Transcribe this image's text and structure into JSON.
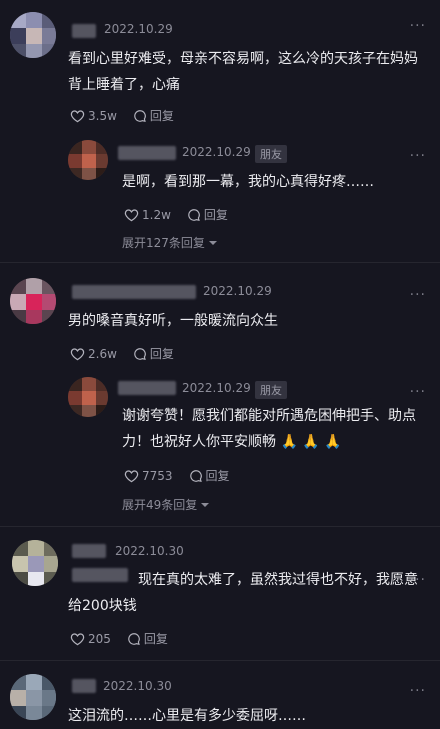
{
  "comments": [
    {
      "date": "2022.10.29",
      "text_lines": [
        "看到心里好难受，母亲不容易啊，这么冷的天孩子在妈妈",
        "背上睡着了，心痛"
      ],
      "likes": "3.5w",
      "reply_label": "回复",
      "more": "···",
      "reply": {
        "date": "2022.10.29",
        "badge": "朋友",
        "text_lines": [
          "是啊，看到那一幕，我的心真得好疼……"
        ],
        "likes": "1.2w",
        "reply_label": "回复",
        "more": "···"
      },
      "expand_label": "展开127条回复"
    },
    {
      "date": "2022.10.29",
      "text_lines": [
        "男的嗓音真好听，一般暖流向众生"
      ],
      "likes": "2.6w",
      "reply_label": "回复",
      "more": "···",
      "reply": {
        "date": "2022.10.29",
        "badge": "朋友",
        "text_lines": [
          "谢谢夸赞！愿我们都能对所遇危困伸把手、助点",
          "力！也祝好人你平安顺畅 🙏 🙏 🙏"
        ],
        "likes": "7753",
        "reply_label": "回复",
        "more": "···"
      },
      "expand_label": "展开49条回复"
    },
    {
      "date": "2022.10.30",
      "text_lines": [
        "现在真的太难了，虽然我过得也不好，我愿意",
        "给200块钱"
      ],
      "likes": "205",
      "reply_label": "回复",
      "more": "···"
    },
    {
      "date": "2022.10.30",
      "text_lines": [
        "这泪流的……心里是有多少委屈呀……"
      ],
      "more": "···"
    }
  ],
  "colors": {
    "background": "#161620",
    "text": "#ececf0",
    "muted": "#8c8c98",
    "badge_bg": "#33333f"
  },
  "icons": {
    "like": "heart-outline-icon",
    "reply": "chat-bubble-icon",
    "expand": "chevron-down-icon",
    "more": "more-dots-icon"
  }
}
